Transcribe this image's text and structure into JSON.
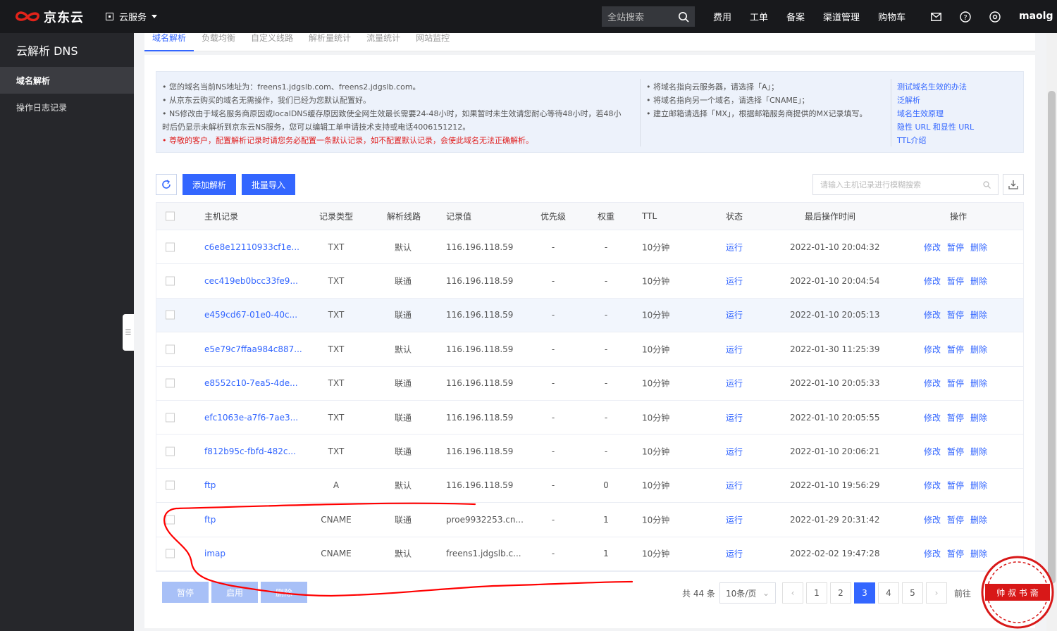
{
  "topbar": {
    "brand": "京东云",
    "cloud_services": "云服务",
    "search_placeholder": "全站搜索",
    "nav": [
      "费用",
      "工单",
      "备案",
      "渠道管理",
      "购物车"
    ],
    "username": "maolg",
    "icons": [
      "mail-icon",
      "help-icon",
      "settings-icon"
    ]
  },
  "sidebar": {
    "title": "云解析 DNS",
    "items": [
      {
        "label": "域名解析",
        "active": true
      },
      {
        "label": "操作日志记录",
        "active": false
      }
    ]
  },
  "tabs": [
    "域名解析",
    "负载均衡",
    "自定义线路",
    "解析量统计",
    "流量统计",
    "网站监控"
  ],
  "notice": {
    "left_lines": [
      "• 您的域名当前NS地址为：freens1.jdgslb.com、freens2.jdgslb.com。",
      "• 从京东云购买的域名无需操作，我们已经为您默认配置好。",
      "• NS修改由于域名服务商原因或localDNS缓存原因致使全网生效最长需要24-48小时，如果暂时未生效请您耐心等待48小时，若48小",
      "时后仍显示未解析到京东云NS服务，您可以编辑工单申请技术支持或电话4006151212。"
    ],
    "warning": "• 尊敬的客户，配置解析记录时请您务必配置一条默认记录，如不配置默认记录，会使此域名无法正确解析。",
    "middle_lines": [
      "• 将域名指向云服务器，请选择「A」；",
      "• 将域名指向另一个域名，请选择「CNAME」；",
      "• 建立邮箱请选择「MX」，根据邮箱服务商提供的MX记录填写。"
    ],
    "links": [
      "测试域名生效的办法",
      "泛解析",
      "域名生效原理",
      "隐性 URL 和显性 URL",
      "TTL介绍"
    ]
  },
  "toolbar": {
    "add_label": "添加解析",
    "import_label": "批量导入",
    "search_placeholder": "请输入主机记录进行模糊搜索"
  },
  "table": {
    "headers": [
      "主机记录",
      "记录类型",
      "解析线路",
      "记录值",
      "优先级",
      "权重",
      "TTL",
      "状态",
      "最后操作时间",
      "操作"
    ],
    "rows": [
      {
        "host": "c6e8e12110933cf1e...",
        "type": "TXT",
        "line": "默认",
        "value": "116.196.118.59",
        "priority": "-",
        "weight": "-",
        "ttl": "10分钟",
        "status": "运行",
        "time": "2022-01-10 20:04:32"
      },
      {
        "host": "cec419eb0bcc33fe9...",
        "type": "TXT",
        "line": "联通",
        "value": "116.196.118.59",
        "priority": "-",
        "weight": "-",
        "ttl": "10分钟",
        "status": "运行",
        "time": "2022-01-10 20:04:54"
      },
      {
        "host": "e459cd67-01e0-40c...",
        "type": "TXT",
        "line": "联通",
        "value": "116.196.118.59",
        "priority": "-",
        "weight": "-",
        "ttl": "10分钟",
        "status": "运行",
        "time": "2022-01-10 20:05:13"
      },
      {
        "host": "e5e79c7ffaa984c887...",
        "type": "TXT",
        "line": "默认",
        "value": "116.196.118.59",
        "priority": "-",
        "weight": "-",
        "ttl": "10分钟",
        "status": "运行",
        "time": "2022-01-30 11:25:39"
      },
      {
        "host": "e8552c10-7ea5-4de...",
        "type": "TXT",
        "line": "联通",
        "value": "116.196.118.59",
        "priority": "-",
        "weight": "-",
        "ttl": "10分钟",
        "status": "运行",
        "time": "2022-01-10 20:05:33"
      },
      {
        "host": "efc1063e-a7f6-7ae3...",
        "type": "TXT",
        "line": "联通",
        "value": "116.196.118.59",
        "priority": "-",
        "weight": "-",
        "ttl": "10分钟",
        "status": "运行",
        "time": "2022-01-10 20:05:55"
      },
      {
        "host": "f812b95c-fbfd-482c...",
        "type": "TXT",
        "line": "联通",
        "value": "116.196.118.59",
        "priority": "-",
        "weight": "-",
        "ttl": "10分钟",
        "status": "运行",
        "time": "2022-01-10 20:06:21"
      },
      {
        "host": "ftp",
        "type": "A",
        "line": "默认",
        "value": "116.196.118.59",
        "priority": "-",
        "weight": "0",
        "ttl": "10分钟",
        "status": "运行",
        "time": "2022-01-10 19:56:29"
      },
      {
        "host": "ftp",
        "type": "CNAME",
        "line": "联通",
        "value": "proe9932253.cn...",
        "priority": "-",
        "weight": "1",
        "ttl": "10分钟",
        "status": "运行",
        "time": "2022-01-29 20:31:42"
      },
      {
        "host": "imap",
        "type": "CNAME",
        "line": "默认",
        "value": "freens1.jdgslb.c...",
        "priority": "-",
        "weight": "1",
        "ttl": "10分钟",
        "status": "运行",
        "time": "2022-02-02 19:47:28"
      }
    ],
    "ops": [
      "修改",
      "暂停",
      "删除"
    ]
  },
  "bulk": [
    "暂停",
    "启用",
    "删除"
  ],
  "pagination": {
    "total": "共 44 条",
    "page_size": "10条/页",
    "pages": [
      "1",
      "2",
      "3",
      "4",
      "5"
    ],
    "current": "3",
    "goto": "前往"
  },
  "stamp": {
    "text": "帅 叔 书 斋"
  },
  "colors": {
    "accent": "#3366ff",
    "topbar": "#18191c",
    "sidebar": "#26272b",
    "warning": "#e02020",
    "annotation": "#ff0000"
  }
}
